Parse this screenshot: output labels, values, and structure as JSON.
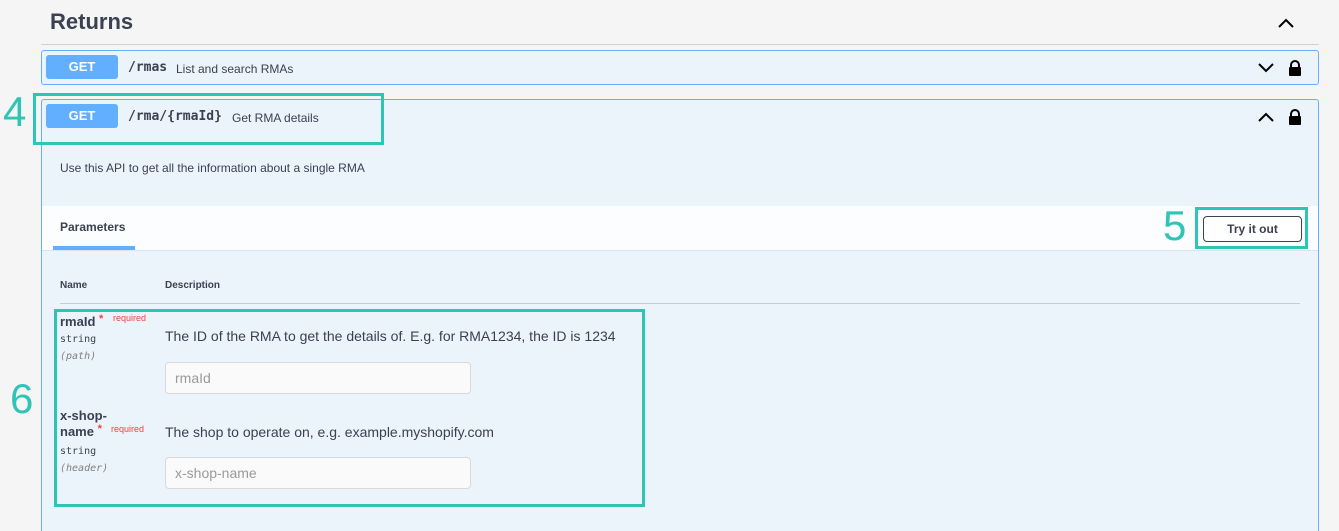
{
  "section": {
    "title": "Returns",
    "chevron_icon": "chevron-up-icon"
  },
  "operations": [
    {
      "method": "GET",
      "path": "/rmas",
      "summary": "List and search RMAs",
      "expanded": false
    },
    {
      "method": "GET",
      "path": "/rma/{rmaId}",
      "summary": "Get RMA details",
      "expanded": true,
      "description": "Use this API to get all the information about a single RMA"
    }
  ],
  "parameters": {
    "tab_label": "Parameters",
    "try_button": "Try it out",
    "col_name": "Name",
    "col_description": "Description",
    "items": [
      {
        "name": "rmaId",
        "required_star": "*",
        "required_label": "required",
        "type": "string",
        "in": "(path)",
        "description": "The ID of the RMA to get the details of. E.g. for RMA1234, the ID is 1234",
        "placeholder": "rmaId"
      },
      {
        "name_line1": "x-shop-",
        "name_line2": "name",
        "required_star": "*",
        "required_label": "required",
        "type": "string",
        "in": "(header)",
        "description": "The shop to operate on, e.g. example.myshopify.com",
        "placeholder": "x-shop-name"
      }
    ]
  },
  "annotations": {
    "a4": "4",
    "a5": "5",
    "a6": "6"
  },
  "colors": {
    "get": "#61affe",
    "annotation": "#2ec4b6",
    "required": "#f93e3e"
  }
}
